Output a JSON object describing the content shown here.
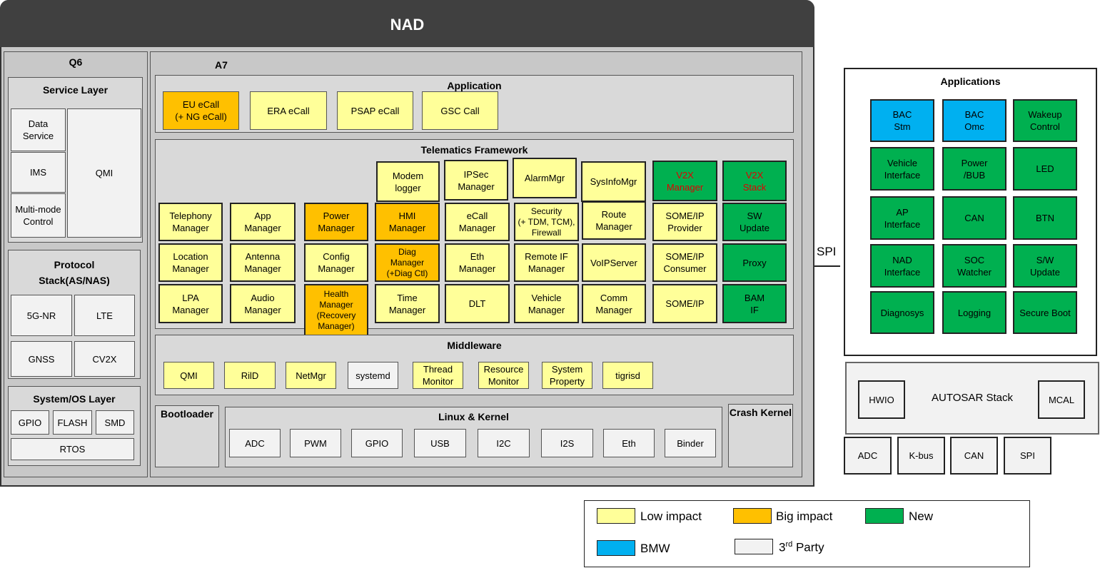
{
  "nad": {
    "title": "NAD",
    "q6": {
      "title": "Q6",
      "service_layer": {
        "title": "Service Layer",
        "items": [
          "Data\nService",
          "IMS",
          "Multi-mode\nControl"
        ],
        "qmi": "QMI"
      },
      "protocol_stack": {
        "title": "Protocol\nStack(AS/NAS)",
        "items": [
          "5G-NR",
          "LTE",
          "GNSS",
          "CV2X"
        ]
      },
      "system_os": {
        "title": "System/OS Layer",
        "items": [
          "GPIO",
          "FLASH",
          "SMD"
        ],
        "rtos": "RTOS"
      }
    },
    "a7": {
      "title": "A7",
      "application": {
        "title": "Application",
        "items": [
          "EU eCall\n(+ NG eCall)",
          "ERA eCall",
          "PSAP eCall",
          "GSC Call"
        ]
      },
      "telematics": {
        "title": "Telematics Framework",
        "top_row": [
          "Modem\nlogger",
          "IPSec\nManager",
          "AlarmMgr",
          "SysInfoMgr",
          "V2X\nManager",
          "V2X\nStack"
        ],
        "row1": [
          "Telephony\nManager",
          "App\nManager",
          "Power\nManager",
          "HMI\nManager",
          "eCall\nManager",
          "Security\n(+ TDM, TCM),\nFirewall",
          "Route\nManager",
          "SOME/IP\nProvider",
          "SW\nUpdate"
        ],
        "row2": [
          "Location\nManager",
          "Antenna\nManager",
          "Config\nManager",
          "Diag\nManager\n(+Diag Ctl)",
          "Eth\nManager",
          "Remote IF\nManager",
          "VoIPServer",
          "SOME/IP\nConsumer",
          "Proxy"
        ],
        "row3": [
          "LPA\nManager",
          "Audio\nManager",
          "Health\nManager\n(Recovery\nManager)",
          "Time\nManager",
          "DLT",
          "Vehicle\nManager",
          "Comm\nManager",
          "SOME/IP",
          "BAM\nIF"
        ]
      },
      "middleware": {
        "title": "Middleware",
        "items": [
          "QMI",
          "RilD",
          "NetMgr",
          "systemd",
          "Thread\nMonitor",
          "Resource\nMonitor",
          "System\nProperty",
          "tigrisd"
        ]
      },
      "bootloader": "Bootloader",
      "linux_kernel": {
        "title": "Linux & Kernel",
        "items": [
          "ADC",
          "PWM",
          "GPIO",
          "USB",
          "I2C",
          "I2S",
          "Eth",
          "Binder"
        ]
      },
      "crash_kernel": "Crash Kernel"
    }
  },
  "spi_label": "SPI",
  "right": {
    "applications": {
      "title": "Applications",
      "items": [
        "BAC\nStm",
        "BAC\nOmc",
        "Wakeup\nControl",
        "Vehicle\nInterface",
        "Power\n/BUB",
        "LED",
        "AP\nInterface",
        "CAN",
        "BTN",
        "NAD\nInterface",
        "SOC\nWatcher",
        "S/W\nUpdate",
        "Diagnosys",
        "Logging",
        "Secure Boot"
      ]
    },
    "autosar": {
      "title": "AUTOSAR Stack",
      "hwio": "HWIO",
      "mcal": "MCAL"
    },
    "peripherals": [
      "ADC",
      "K-bus",
      "CAN",
      "SPI"
    ]
  },
  "legend": {
    "low": "Low impact",
    "big": "Big impact",
    "new": "New",
    "bmw": "BMW",
    "third_pre": "3",
    "third_sup": "rd",
    "third_post": " Party"
  },
  "colors": {
    "low": "#ffff99",
    "big": "#ffc000",
    "new": "#00b050",
    "bmw": "#00b0f0",
    "third": "#f2f2f2",
    "header": "#404040"
  }
}
